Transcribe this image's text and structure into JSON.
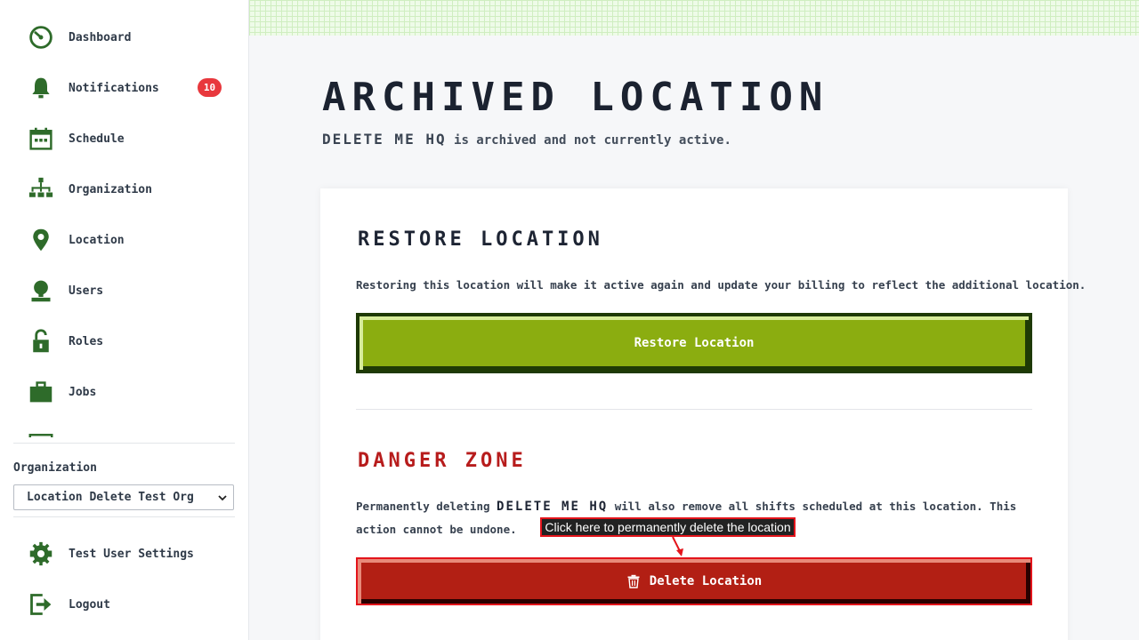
{
  "sidebar": {
    "items": [
      {
        "label": "Dashboard",
        "icon": "dashboard-icon"
      },
      {
        "label": "Notifications",
        "icon": "bell-icon",
        "badge": "10"
      },
      {
        "label": "Schedule",
        "icon": "calendar-icon"
      },
      {
        "label": "Organization",
        "icon": "org-chart-icon"
      },
      {
        "label": "Location",
        "icon": "location-pin-icon"
      },
      {
        "label": "Users",
        "icon": "user-icon"
      },
      {
        "label": "Roles",
        "icon": "unlock-icon"
      },
      {
        "label": "Jobs",
        "icon": "briefcase-icon"
      }
    ],
    "org_label": "Organization",
    "org_select_value": "Location Delete Test Org",
    "bottom_items": [
      {
        "label": "Test User Settings",
        "icon": "gear-icon"
      },
      {
        "label": "Logout",
        "icon": "logout-icon"
      }
    ]
  },
  "main": {
    "title": "ARCHIVED LOCATION",
    "subtitle_name": "DELETE ME HQ",
    "subtitle_rest": " is archived and not currently active.",
    "restore": {
      "title": "RESTORE LOCATION",
      "description": "Restoring this location will make it active again and update your billing to reflect the additional location.",
      "button_label": "Restore Location"
    },
    "danger": {
      "title": "DANGER ZONE",
      "desc_prefix": "Permanently deleting ",
      "desc_name": "DELETE ME HQ",
      "desc_suffix": " will also remove all shifts scheduled at this location. This action cannot be undone.",
      "button_label": "Delete Location",
      "tooltip": "Click here to permanently delete the location"
    }
  },
  "colors": {
    "icon_green": "#2e6b2a",
    "restore_green": "#8bad10",
    "danger_red": "#b21f14",
    "badge_red": "#e8383d"
  }
}
